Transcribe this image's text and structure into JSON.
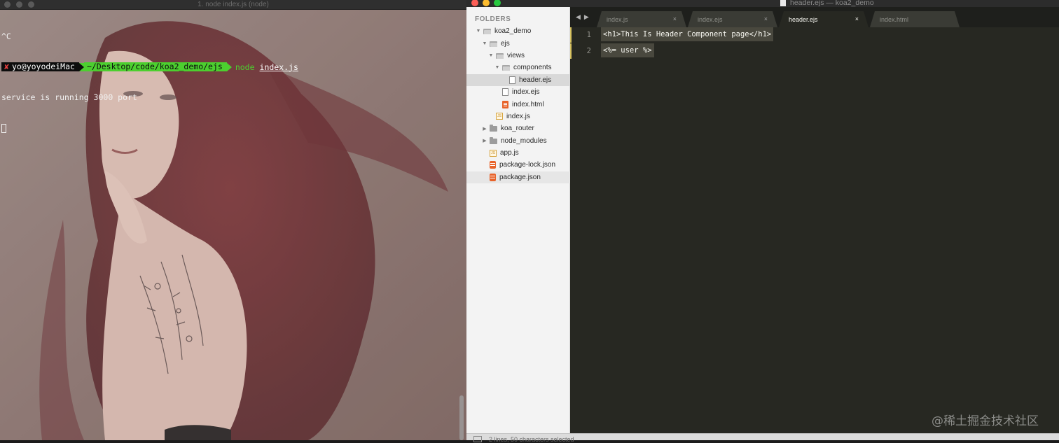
{
  "terminal": {
    "title": "1. node index.js (node)",
    "lines": {
      "ctrl_c": "^C",
      "prompt_marker": "✘",
      "prompt_user": "yo@yoyodeiMac",
      "prompt_path": "~/Desktop/code/koa2_demo/ejs",
      "command": "node",
      "command_arg": "index.js",
      "output": "service is running 3000 port"
    }
  },
  "editor": {
    "window_title": "header.ejs — koa2_demo",
    "sidebar": {
      "heading": "FOLDERS",
      "items": [
        {
          "label": "koa2_demo",
          "type": "folder-open",
          "depth": 0
        },
        {
          "label": "ejs",
          "type": "folder-open",
          "depth": 1
        },
        {
          "label": "views",
          "type": "folder-open",
          "depth": 2
        },
        {
          "label": "components",
          "type": "folder-open",
          "depth": 3
        },
        {
          "label": "header.ejs",
          "type": "file",
          "depth": 4
        },
        {
          "label": "index.ejs",
          "type": "file",
          "depth": 3
        },
        {
          "label": "index.html",
          "type": "html",
          "depth": 3
        },
        {
          "label": "index.js",
          "type": "js",
          "depth": 2
        },
        {
          "label": "koa_router",
          "type": "folder",
          "depth": 1
        },
        {
          "label": "node_modules",
          "type": "folder",
          "depth": 1
        },
        {
          "label": "app.js",
          "type": "js",
          "depth": 1
        },
        {
          "label": "package-lock.json",
          "type": "json",
          "depth": 1
        },
        {
          "label": "package.json",
          "type": "json",
          "depth": 1
        }
      ]
    },
    "tabs": [
      {
        "label": "index.js",
        "close": "×"
      },
      {
        "label": "index.ejs",
        "close": "×"
      },
      {
        "label": "header.ejs",
        "close": "×",
        "active": true
      },
      {
        "label": "index.html",
        "close": ""
      }
    ],
    "code": [
      {
        "num": "1",
        "text": "<h1>This Is Header Component page</h1>"
      },
      {
        "num": "2",
        "text": "<%= user %>"
      }
    ],
    "status": "2 lines, 50 characters selected"
  },
  "watermark": "@稀土掘金技术社区",
  "colors": {
    "terminal_prompt_path_bg": "#4ccf2f",
    "editor_bg": "#272822",
    "selection_bg": "#49483e",
    "sidebar_bg": "#f3f3f3"
  }
}
